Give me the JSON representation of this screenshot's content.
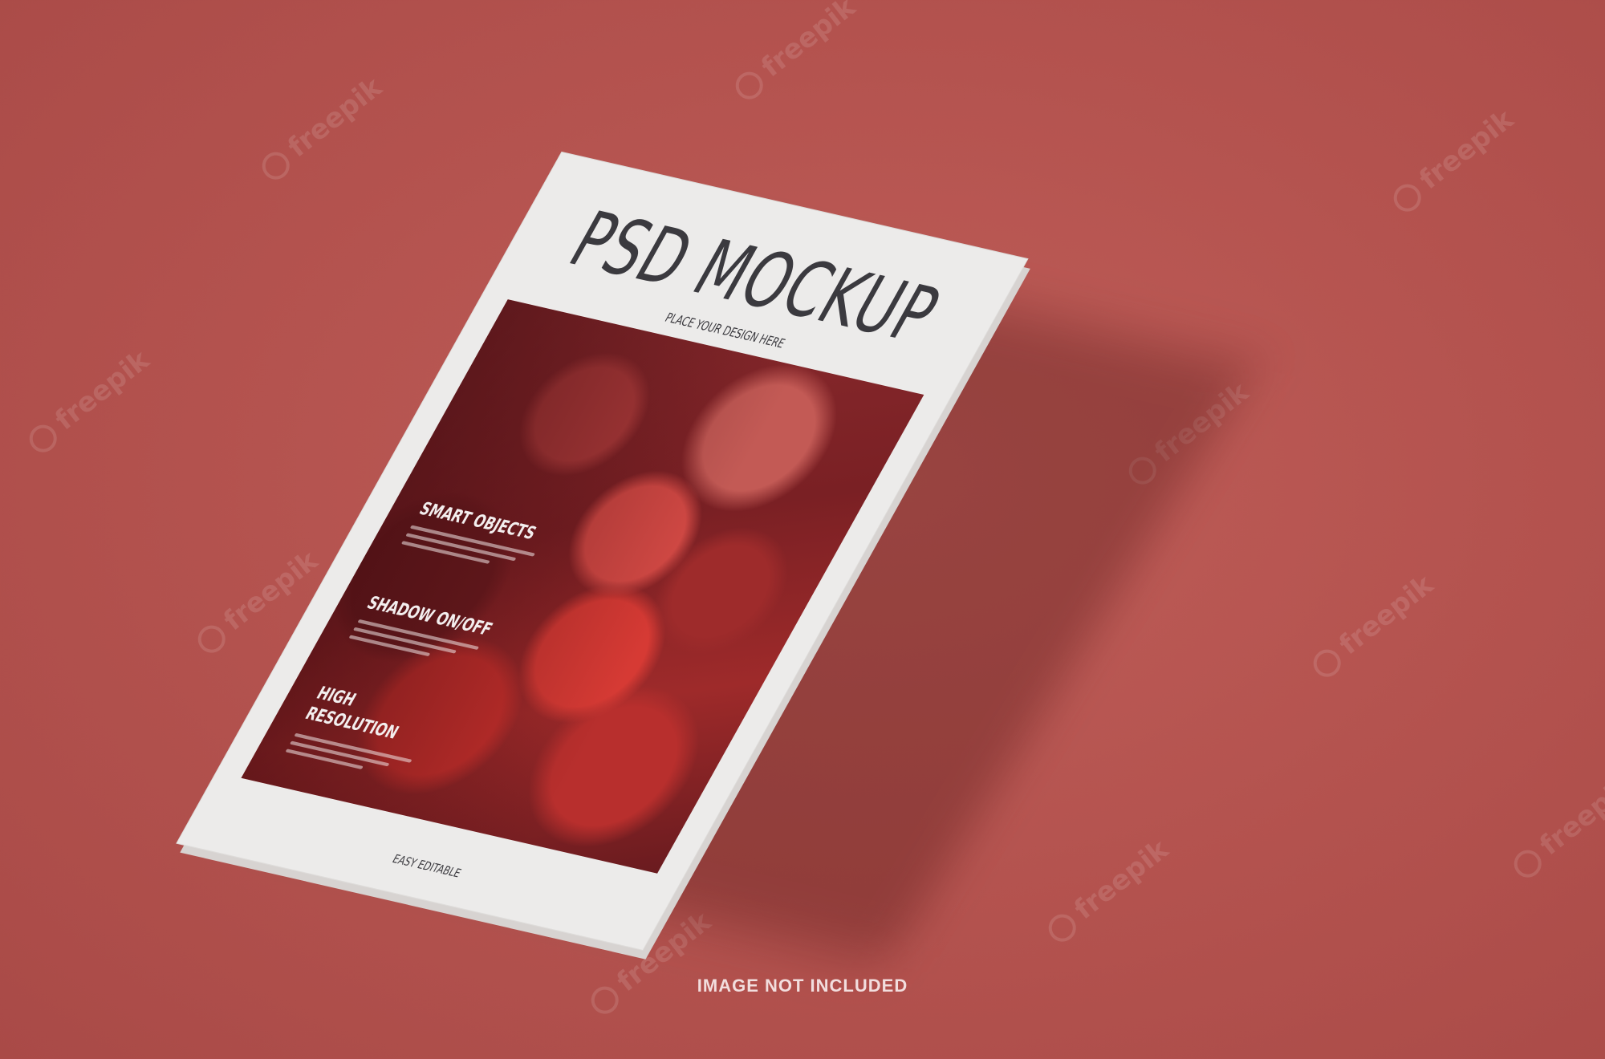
{
  "magazine": {
    "title": "PSD MOCKUP",
    "subtitle": "PLACE YOUR DESIGN HERE",
    "features": [
      "SMART OBJECTS",
      "SHADOW ON/OFF",
      "HIGH\nRESOLUTION"
    ],
    "footer": "EASY EDITABLE"
  },
  "caption": "IMAGE NOT INCLUDED",
  "watermark": "freepik",
  "colors": {
    "background": "#b3524e",
    "paper": "#ecebea",
    "title_text": "#3b3a3f",
    "strawberry_red": "#d63a34"
  }
}
